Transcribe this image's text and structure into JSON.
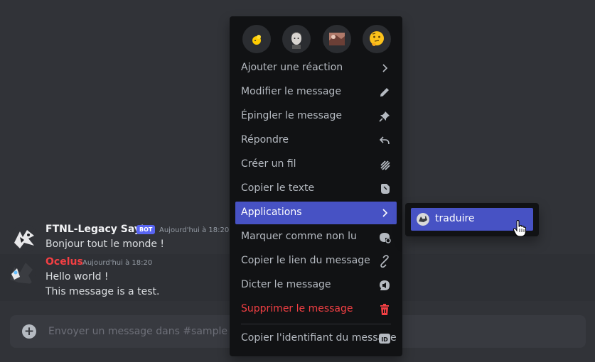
{
  "chat": {
    "messages": [
      {
        "author": "FTNL-Legacy Say's",
        "bot_tag": "BOT",
        "timestamp": "Aujourd'hui à 18:20",
        "lines": [
          "Bonjour tout le monde !"
        ]
      },
      {
        "author": "Ocelus",
        "author_color": "#f23f43",
        "timestamp": "Aujourd'hui à 18:20",
        "lines": [
          "Hello world !",
          "This message is a test."
        ]
      }
    ]
  },
  "composer": {
    "placeholder": "Envoyer un message dans #sample",
    "value": ""
  },
  "context_menu": {
    "reactions": [
      "yellow-blob-emoji",
      "person-avatar-emoji",
      "photo-emoji",
      "thinking-face-emoji"
    ],
    "items": [
      {
        "label": "Ajouter une réaction",
        "icon": "chevron-right-icon"
      },
      {
        "label": "Modifier le message",
        "icon": "pencil-icon"
      },
      {
        "label": "Épingler le message",
        "icon": "pin-icon"
      },
      {
        "label": "Répondre",
        "icon": "reply-icon"
      },
      {
        "label": "Créer un fil",
        "icon": "thread-icon"
      },
      {
        "label": "Copier le texte",
        "icon": "copy-icon"
      },
      {
        "label": "Applications",
        "icon": "chevron-right-icon",
        "active": true
      },
      {
        "label": "Marquer comme non lu",
        "icon": "mark-unread-icon"
      },
      {
        "label": "Copier le lien du message",
        "icon": "link-icon"
      },
      {
        "label": "Dicter le message",
        "icon": "speaker-icon"
      },
      {
        "label": "Supprimer le message",
        "icon": "trash-icon",
        "danger": true
      },
      {
        "label": "Copier l'identifiant du message",
        "icon": "id-icon"
      }
    ]
  },
  "submenu": {
    "items": [
      {
        "label": "traduire",
        "icon": "app-avatar-icon"
      }
    ]
  },
  "colors": {
    "background": "#313338",
    "menu_bg": "#111214",
    "accent": "#4752c4",
    "danger": "#f23f43",
    "bot_tag": "#5865f2"
  }
}
